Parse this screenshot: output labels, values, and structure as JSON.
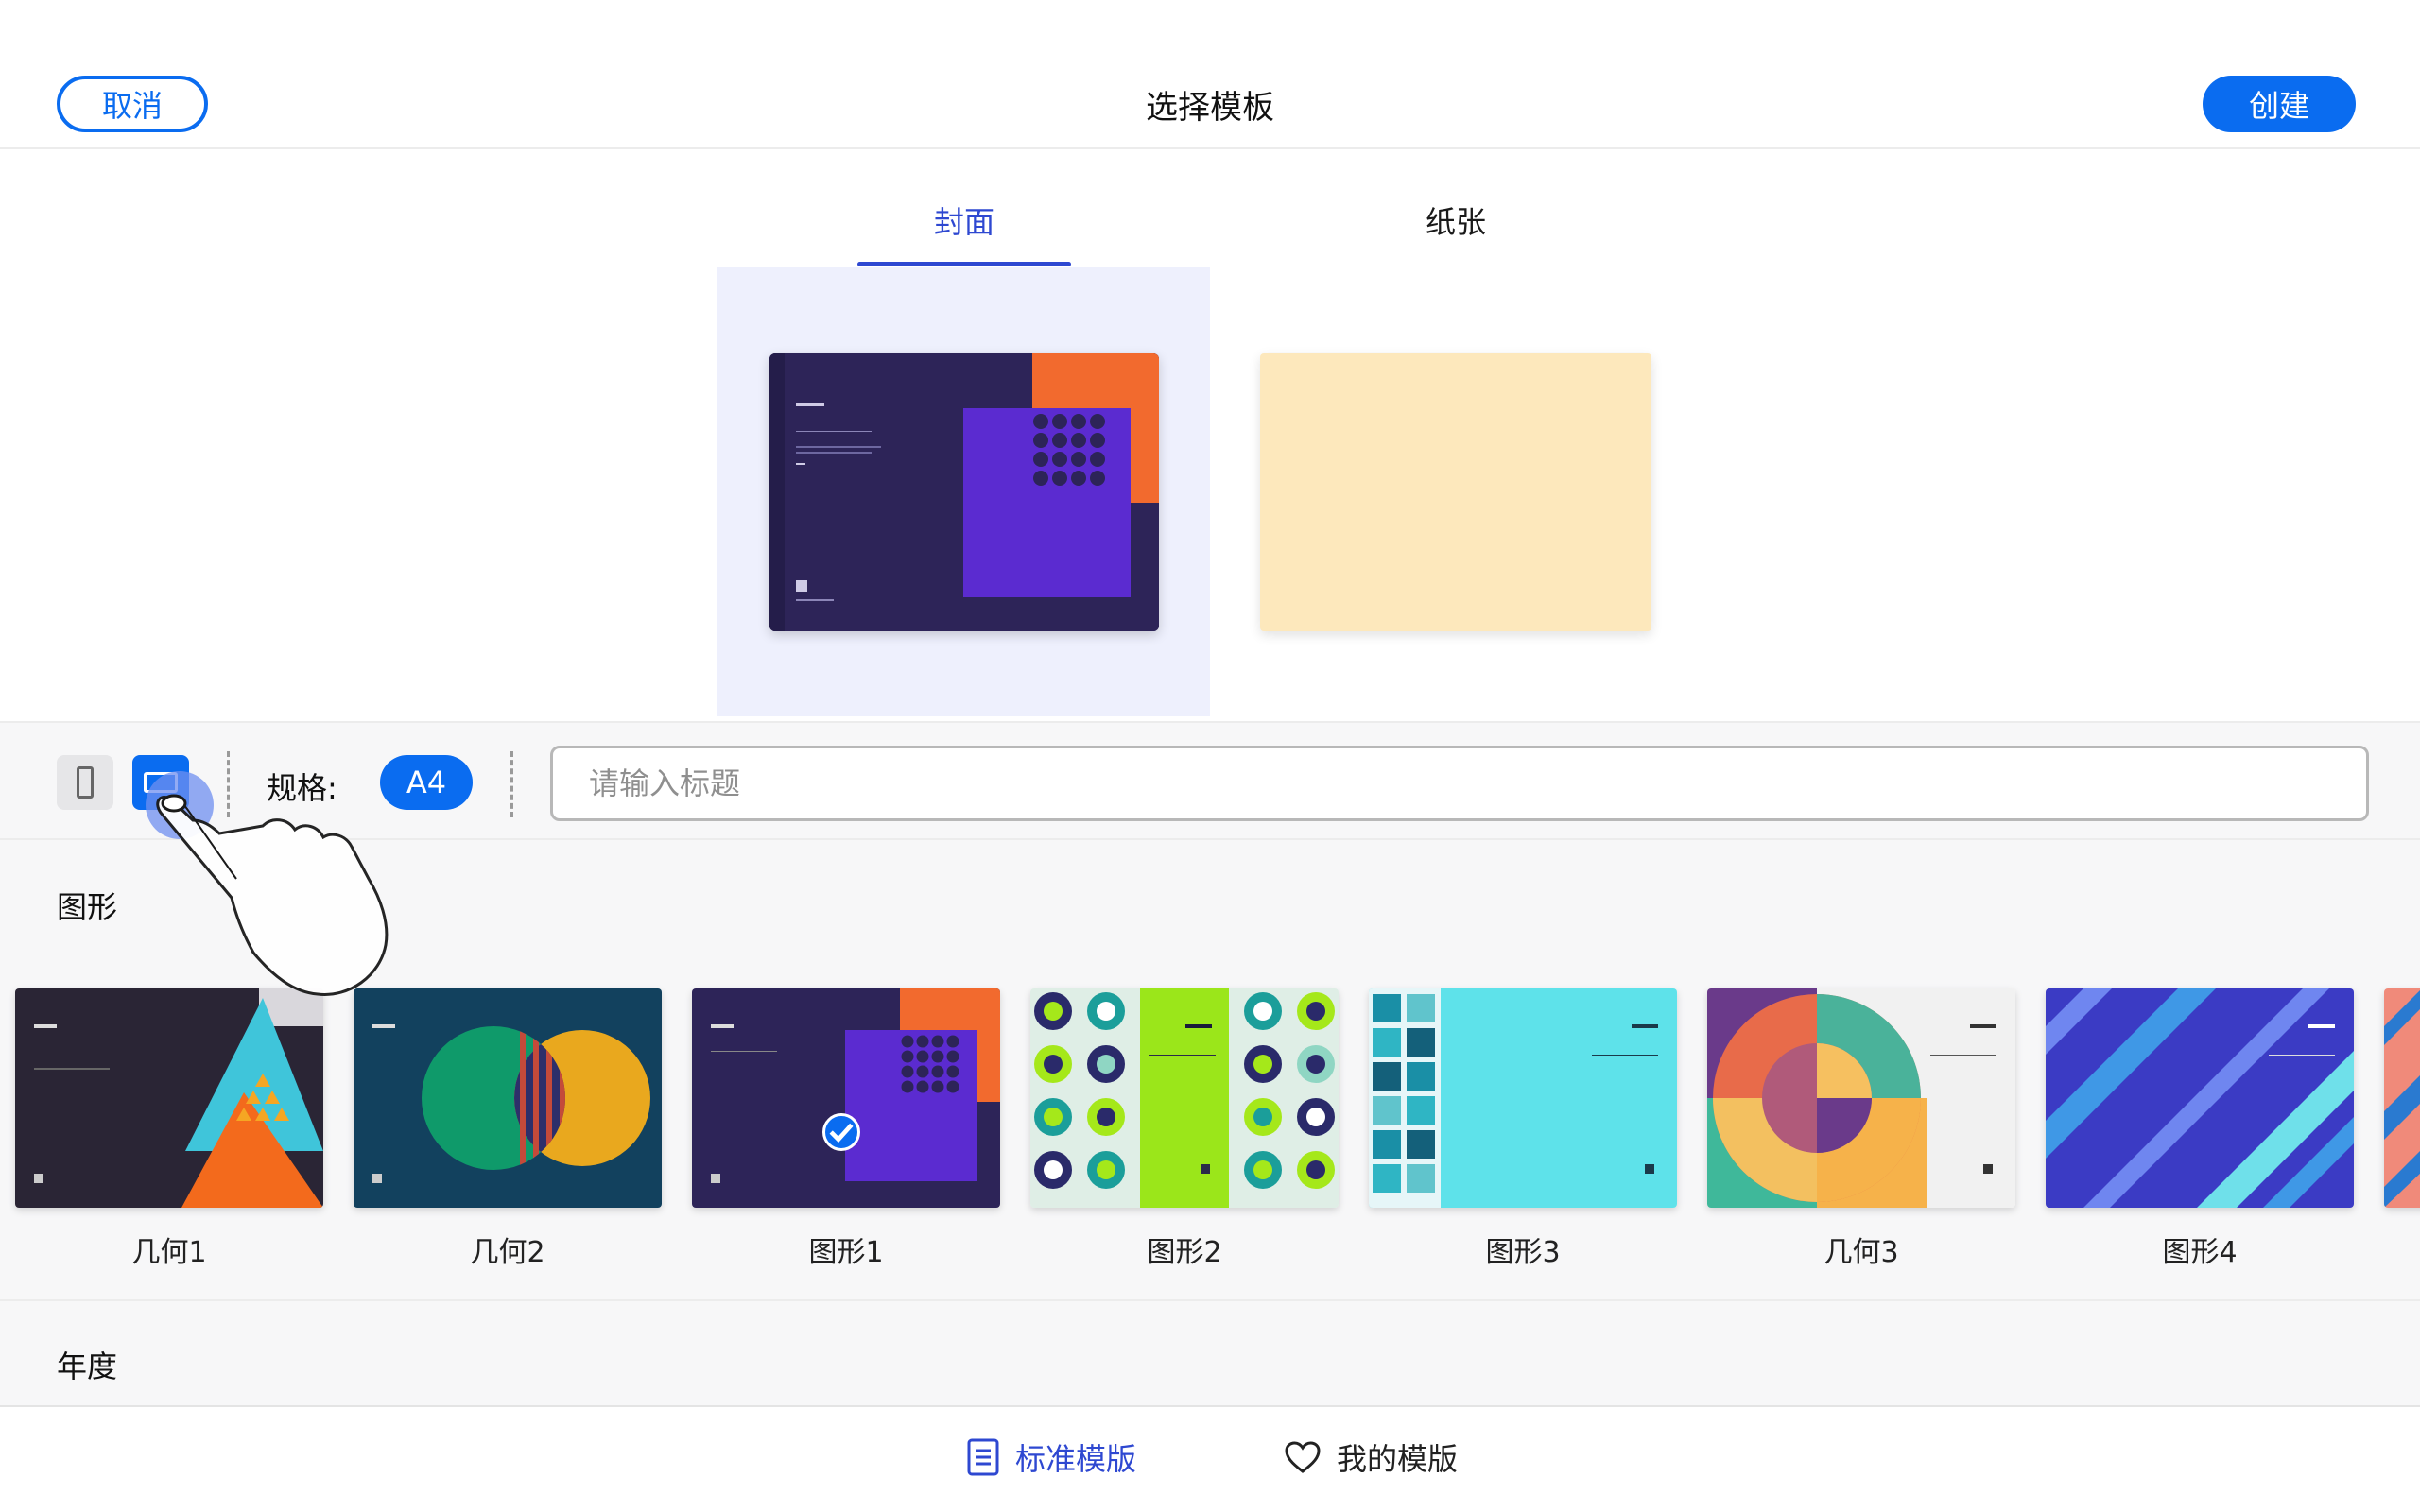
{
  "header": {
    "cancel_label": "取消",
    "title": "选择模板",
    "create_label": "创建"
  },
  "tabs": [
    {
      "label": "封面",
      "active": true
    },
    {
      "label": "纸张",
      "active": false
    }
  ],
  "preview": {
    "selected": "cover",
    "paper_color": "#fde8bc"
  },
  "toolbar": {
    "orientation_selected": "landscape",
    "spec_label": "规格:",
    "spec_value": "A4",
    "title_placeholder": "请输入标题",
    "title_value": ""
  },
  "gallery": {
    "section_title": "图形",
    "items": [
      {
        "label": "几何1"
      },
      {
        "label": "几何2"
      },
      {
        "label": "图形1",
        "selected": true
      },
      {
        "label": "图形2"
      },
      {
        "label": "图形3"
      },
      {
        "label": "几何3"
      },
      {
        "label": "图形4"
      }
    ]
  },
  "annual": {
    "section_title": "年度"
  },
  "bottom_nav": {
    "standard_label": "标准模版",
    "mine_label": "我的模版"
  },
  "colors": {
    "accent": "#0a6cf0",
    "tab_active": "#2e48d1"
  }
}
